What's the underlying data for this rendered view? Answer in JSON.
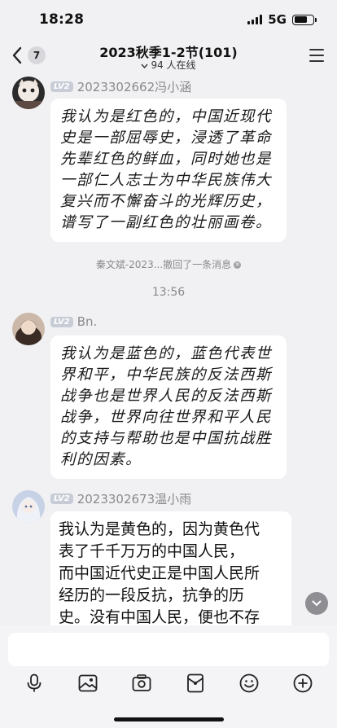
{
  "status_bar": {
    "time": "18:28",
    "network": "5G",
    "battery_fraction": 0.72
  },
  "header": {
    "unread_count": "7",
    "title": "2023秋季1-2节(101)",
    "online": "94 人在线"
  },
  "messages": [
    {
      "level": "LV2",
      "sender": "2023302662冯小涵",
      "lines": [
        "我认为是红色的，中国近现代",
        "史是一部屈辱史，浸透了革命",
        "先辈红色的鲜血，同时她也是",
        "一部仁人志士为中华民族伟大",
        "复兴而不懈奋斗的光辉历史，",
        "谱写了一副红色的壮丽画卷。"
      ]
    },
    {
      "level": "LV2",
      "sender": "Bn.",
      "lines": [
        "我认为是蓝色的，蓝色代表世",
        "界和平，中华民族的反法西斯",
        "战争也是世界人民的反法西斯",
        "战争，世界向往世界和平人民",
        "的支持与帮助也是中国抗战胜",
        "利的因素。"
      ]
    },
    {
      "level": "LV2",
      "sender": "2023302673温小雨",
      "lines": [
        "我认为是黄色的，因为黄色代",
        "表了千千万万的中国人民，",
        "而中国近代史正是中国人民所",
        "经历的一段反抗，抗争的历",
        "史。没有中国人民，便也不存"
      ]
    }
  ],
  "recall_notice": "秦文斌-2023...撤回了一条消息",
  "timestamp": "13:56",
  "input": {
    "value": "",
    "placeholder": ""
  },
  "toolbar": [
    "microphone-icon",
    "image-icon",
    "camera-icon",
    "red-packet-icon",
    "emoji-icon",
    "plus-icon"
  ]
}
